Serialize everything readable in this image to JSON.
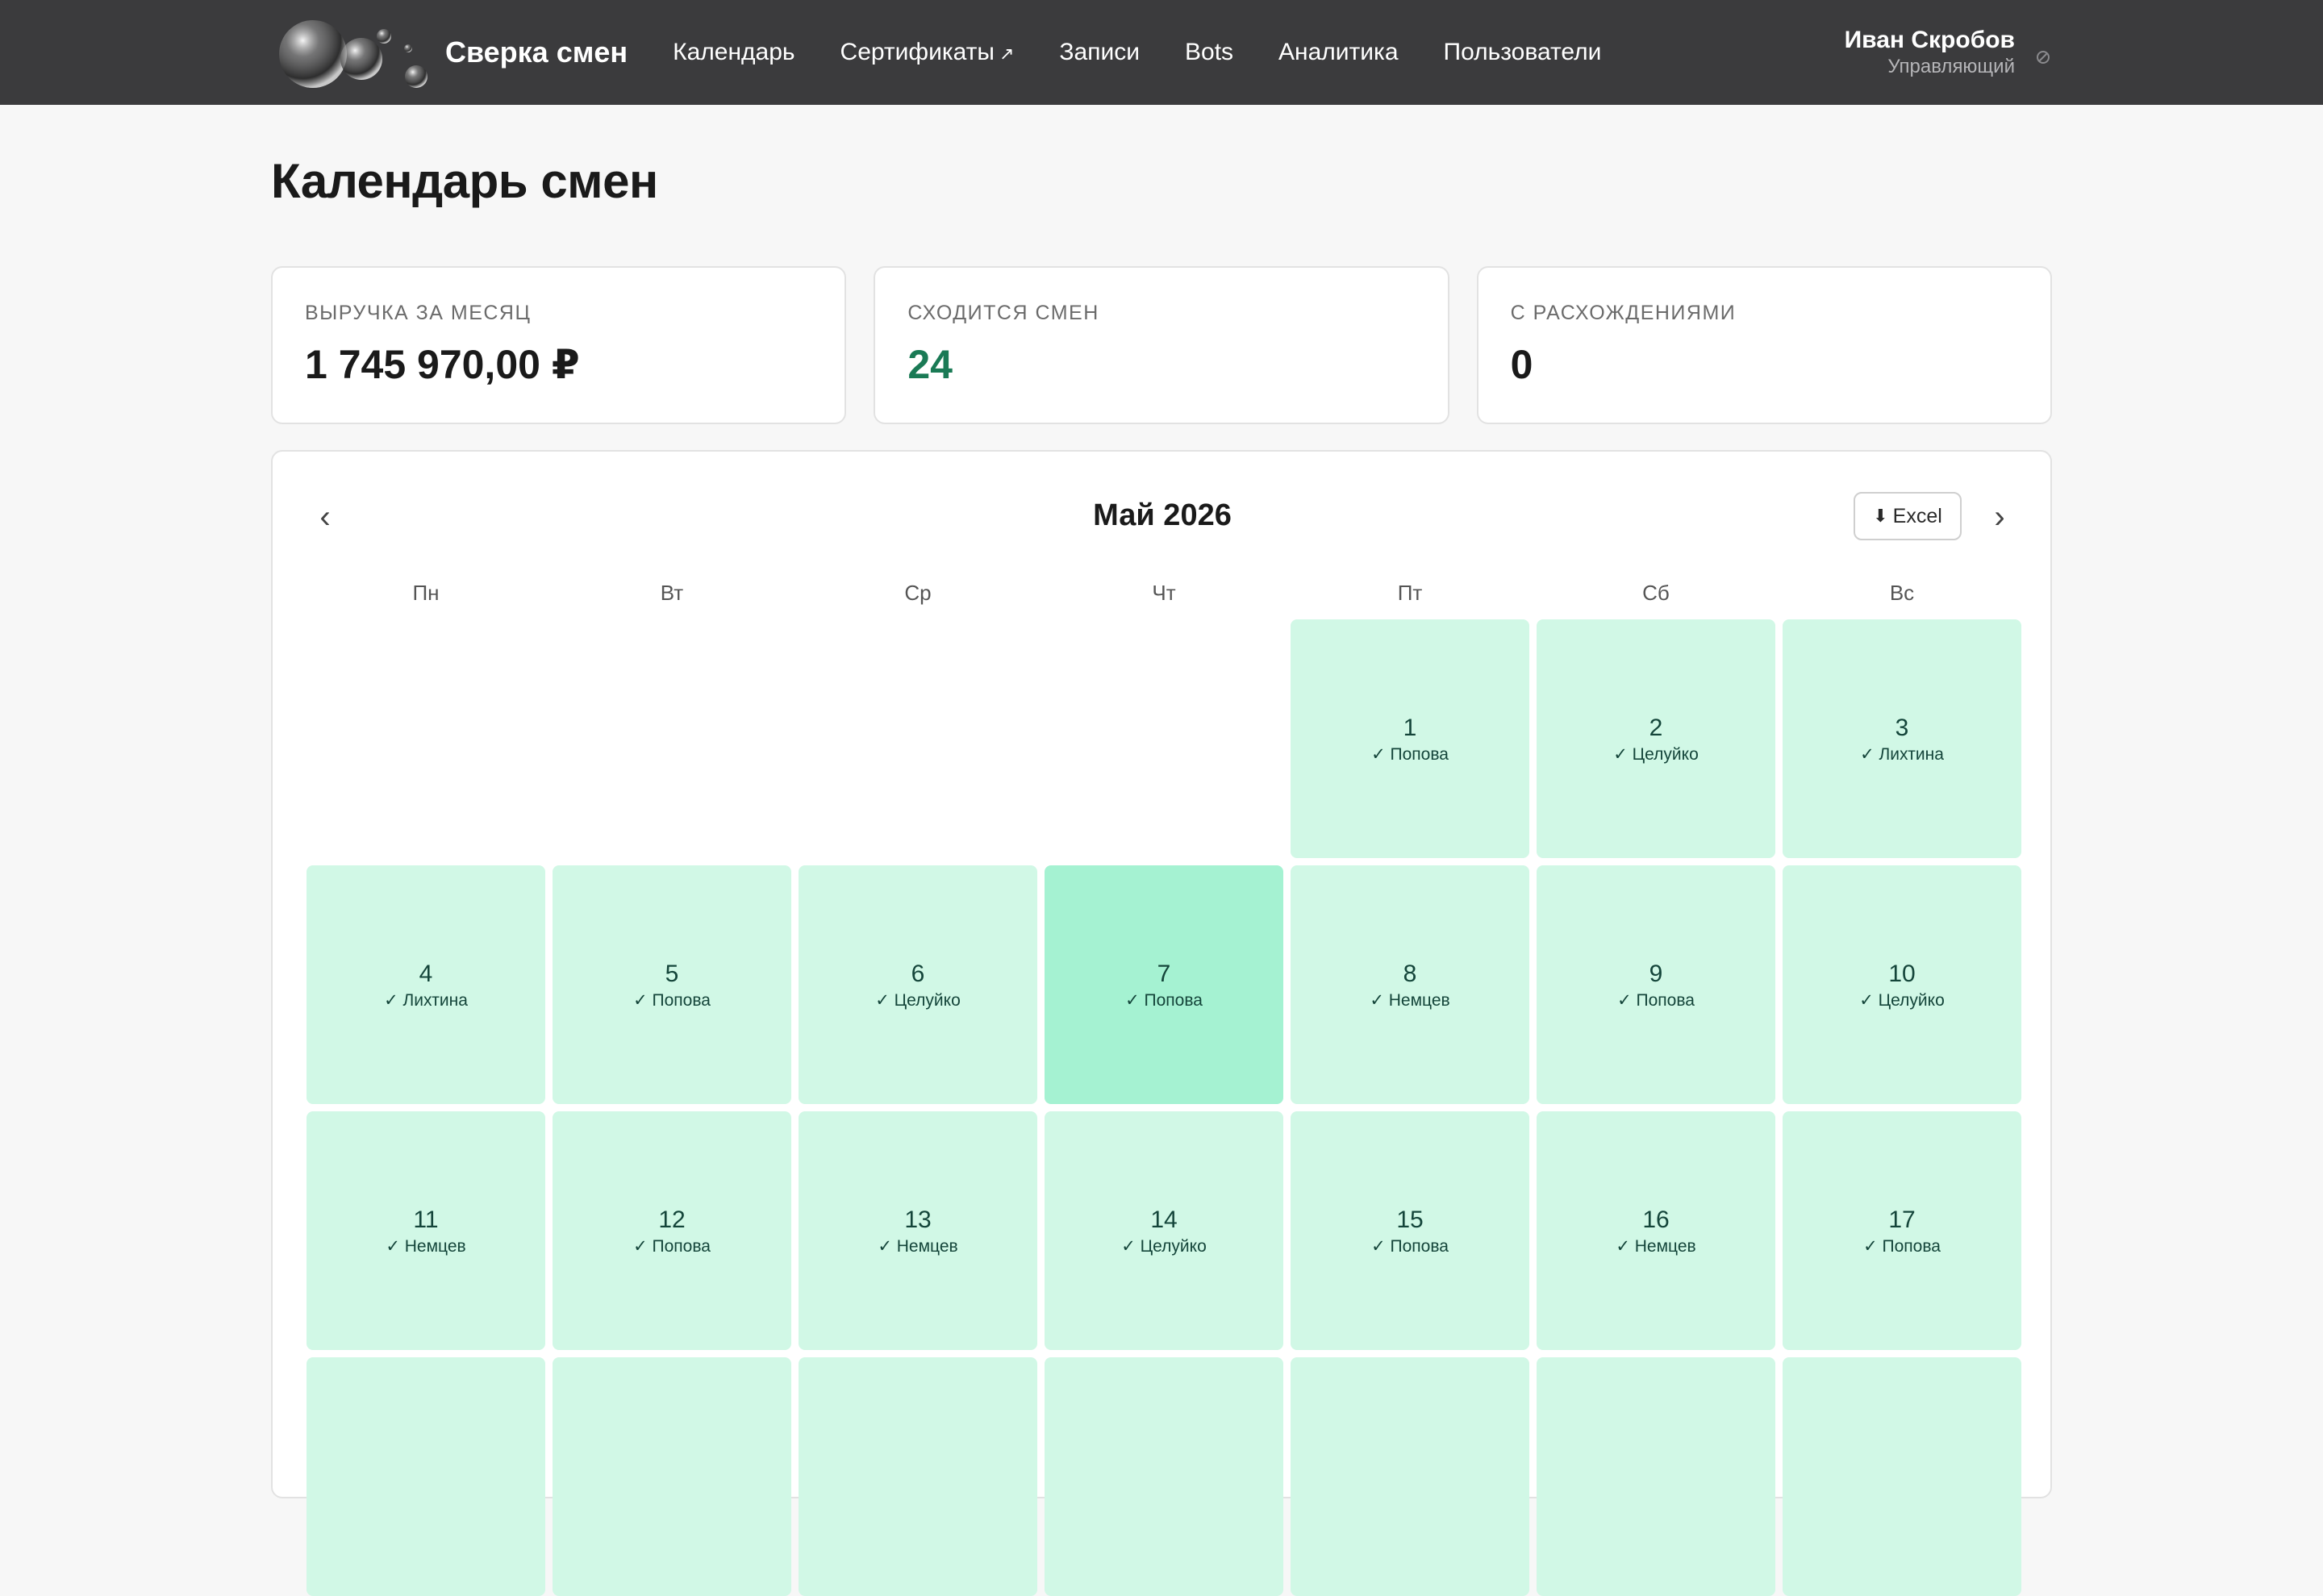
{
  "header": {
    "brand": "Сверка смен",
    "nav": [
      {
        "label": "Календарь",
        "external": false
      },
      {
        "label": "Сертификаты",
        "external": true
      },
      {
        "label": "Записи",
        "external": false
      },
      {
        "label": "Bots",
        "external": false
      },
      {
        "label": "Аналитика",
        "external": false
      },
      {
        "label": "Пользователи",
        "external": false
      }
    ],
    "external_glyph": "↗",
    "user": {
      "name": "Иван Скробов",
      "role": "Управляющий"
    }
  },
  "page": {
    "title": "Календарь смен"
  },
  "stats": [
    {
      "label": "ВЫРУЧКА ЗА МЕСЯЦ",
      "value": "1 745 970,00 ₽",
      "accent": false
    },
    {
      "label": "СХОДИТСЯ СМЕН",
      "value": "24",
      "accent": true
    },
    {
      "label": "С РАСХОЖДЕНИЯМИ",
      "value": "0",
      "accent": false
    }
  ],
  "calendar": {
    "prev_glyph": "‹",
    "next_glyph": "›",
    "title": "Май 2026",
    "excel_label": "Excel",
    "excel_glyph": "⬇",
    "weekdays": [
      "Пн",
      "Вт",
      "Ср",
      "Чт",
      "Пт",
      "Сб",
      "Вс"
    ],
    "leading_empty": 4,
    "today": 7,
    "days": [
      {
        "day": "1",
        "employee": "✓ Попова"
      },
      {
        "day": "2",
        "employee": "✓ Целуйко"
      },
      {
        "day": "3",
        "employee": "✓ Лихтина"
      },
      {
        "day": "4",
        "employee": "✓ Лихтина"
      },
      {
        "day": "5",
        "employee": "✓ Попова"
      },
      {
        "day": "6",
        "employee": "✓ Целуйко"
      },
      {
        "day": "7",
        "employee": "✓ Попова"
      },
      {
        "day": "8",
        "employee": "✓ Немцев"
      },
      {
        "day": "9",
        "employee": "✓ Попова"
      },
      {
        "day": "10",
        "employee": "✓ Целуйко"
      },
      {
        "day": "11",
        "employee": "✓ Немцев"
      },
      {
        "day": "12",
        "employee": "✓ Попова"
      },
      {
        "day": "13",
        "employee": "✓ Немцев"
      },
      {
        "day": "14",
        "employee": "✓ Целуйко"
      },
      {
        "day": "15",
        "employee": "✓ Попова"
      },
      {
        "day": "16",
        "employee": "✓ Немцев"
      },
      {
        "day": "17",
        "employee": "✓ Попова"
      },
      {
        "day": "",
        "employee": ""
      },
      {
        "day": "",
        "employee": ""
      },
      {
        "day": "",
        "employee": ""
      },
      {
        "day": "",
        "employee": ""
      },
      {
        "day": "",
        "employee": ""
      },
      {
        "day": "",
        "employee": ""
      },
      {
        "day": "",
        "employee": ""
      }
    ]
  },
  "colors": {
    "topbar": "#3b3b3d",
    "day_cell": "#d1f8e6",
    "today_cell": "#a5f2d2",
    "accent_green": "#1a7a55"
  },
  "icons": {
    "logo": "bubbles-logo",
    "logout": "logout-icon"
  }
}
